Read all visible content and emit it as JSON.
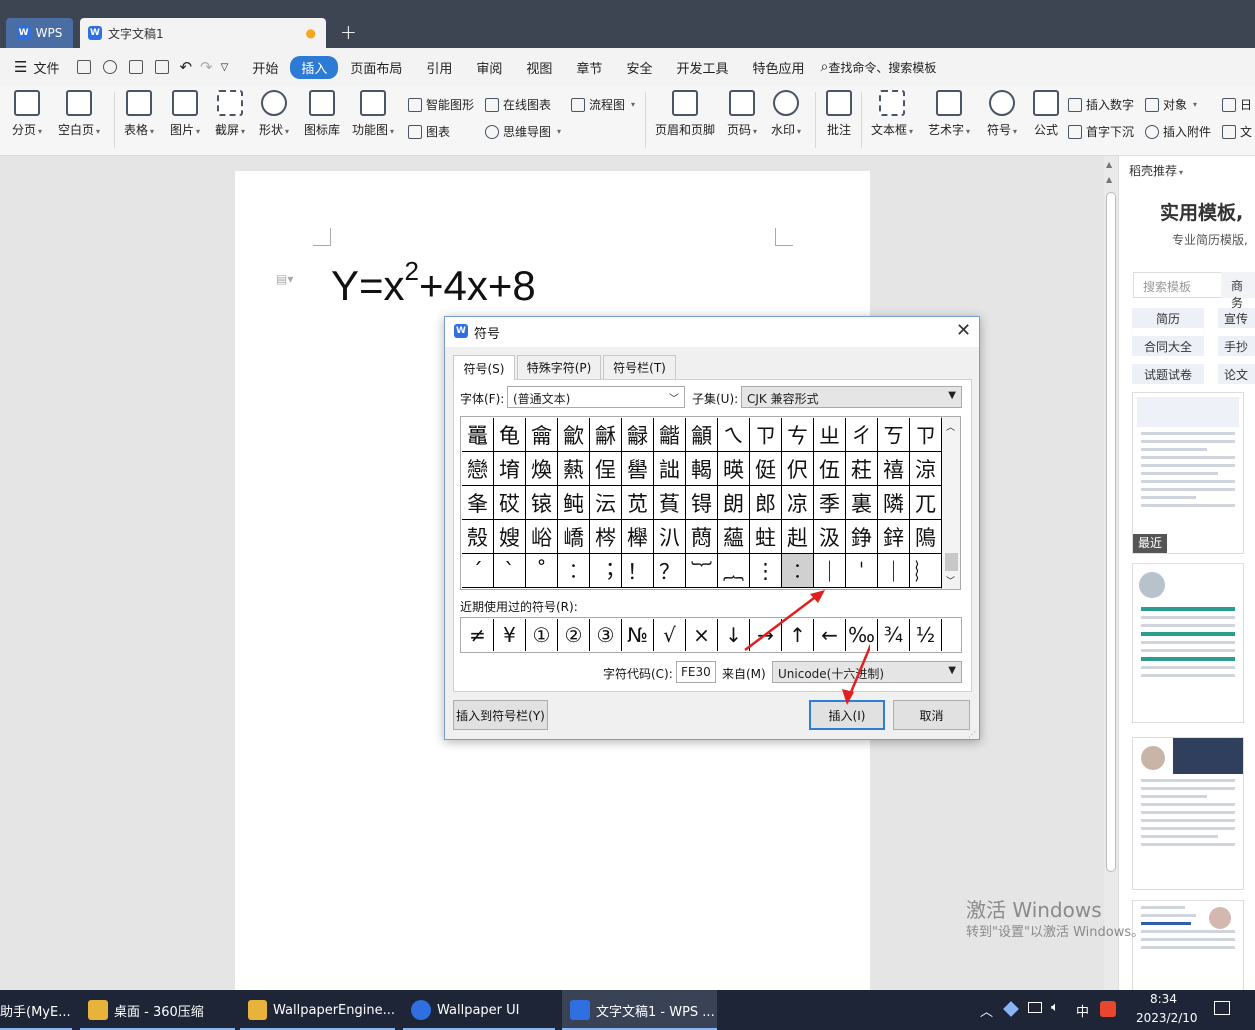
{
  "tabs": {
    "wps": "WPS",
    "doc": "文字文稿1",
    "doc_dot": "●",
    "plus": "+"
  },
  "menu": {
    "file": "文件",
    "items": [
      "开始",
      "插入",
      "页面布局",
      "引用",
      "审阅",
      "视图",
      "章节",
      "安全",
      "开发工具",
      "特色应用"
    ],
    "search": "查找命令、搜索模板"
  },
  "ribbon": {
    "paging": "分页",
    "blank": "空白页",
    "table": "表格",
    "picture": "图片",
    "screenshot": "截屏",
    "shape": "形状",
    "iconlib": "图标库",
    "funcmap": "功能图",
    "smartshape": "智能图形",
    "onlinechart": "在线图表",
    "flowchart": "流程图",
    "chart": "图表",
    "mindmap": "思维导图",
    "headerfooter": "页眉和页脚",
    "pagenum": "页码",
    "watermark": "水印",
    "comment": "批注",
    "textbox": "文本框",
    "wordart": "艺术字",
    "symbol": "符号",
    "formula": "公式",
    "insertnum": "插入数字",
    "object": "对象",
    "dropcap": "首字下沉",
    "attachment": "插入附件",
    "date": "日",
    "doc": "文"
  },
  "document": {
    "base": "Y=x",
    "exp": "2",
    "rest": "+4x+8"
  },
  "panel": {
    "title": "稻壳推荐",
    "heading": "实用模板,",
    "subtitle": "专业简历模版,",
    "search_placeholder": "搜索模板",
    "biz": "商务",
    "tags": [
      "简历",
      "合同大全",
      "试题试卷"
    ],
    "tags2": [
      "宣传",
      "手抄",
      "论文"
    ],
    "recent_badge": "最近"
  },
  "watermark": {
    "line1": "激活 Windows",
    "line2": "转到\"设置\"以激活 Windows。"
  },
  "dialog": {
    "title": "符号",
    "close": "✕",
    "tabs": [
      "符号(S)",
      "特殊字符(P)",
      "符号栏(T)"
    ],
    "font_label": "字体(F):",
    "font_value": "(普通文本)",
    "subset_label": "子集(U):",
    "subset_value": "CJK 兼容形式",
    "grid": [
      [
        "鼉",
        "龟",
        "龠",
        "龡",
        "龢",
        "龣",
        "龤",
        "龥",
        "ㄟ",
        "ㄗ",
        "ㄘ",
        "ㄓ",
        "ㄔ",
        "ㄎ",
        "ㄗ"
      ],
      [
        "戀",
        "堉",
        "煥",
        "爇",
        "侱",
        "嚳",
        "詘",
        "輵",
        "暎",
        "侹",
        "伬",
        "伍",
        "荰",
        "禧",
        "涼"
      ],
      [
        "夆",
        "砹",
        "锿",
        "鲀",
        "沄",
        "苋",
        "萯",
        "锝",
        "朗",
        "郎",
        "凉",
        "季",
        "裏",
        "隣",
        "兀"
      ],
      [
        "殼",
        "嫂",
        "峪",
        "嶠",
        "梣",
        "櫸",
        "汃",
        "蕄",
        "蘊",
        "蛀",
        "赳",
        "汲",
        "錚",
        "鋅",
        "隝"
      ],
      [
        "´",
        "ˋ",
        "˚",
        "︰",
        "︔",
        "！",
        "？",
        "︸",
        "︷",
        "⋮",
        "︰",
        "｜",
        "ˈ",
        "｜",
        "︴"
      ]
    ],
    "recent_label": "近期使用过的符号(R):",
    "recent": [
      "≠",
      "¥",
      "①",
      "②",
      "③",
      "№",
      "√",
      "×",
      "↓",
      "→",
      "↑",
      "←",
      "‰",
      "¾",
      "½"
    ],
    "code_label": "字符代码(C):",
    "code_value": "FE30",
    "from_label": "来自(M)",
    "from_value": "Unicode(十六进制)",
    "btn_toolbar": "插入到符号栏(Y)",
    "btn_insert": "插入(I)",
    "btn_cancel": "取消"
  },
  "taskbar": {
    "items": [
      "助手(MyE...",
      "桌面 - 360压缩",
      "WallpaperEngine...",
      "Wallpaper UI",
      "文字文稿1 - WPS ..."
    ],
    "tray_lang": "中",
    "time": "8:34",
    "date": "2023/2/10"
  },
  "colors": {
    "accent": "#2e7bd6",
    "titlebar": "#3d4552",
    "taskbar": "#1d2536",
    "arrow": "#e02020"
  }
}
